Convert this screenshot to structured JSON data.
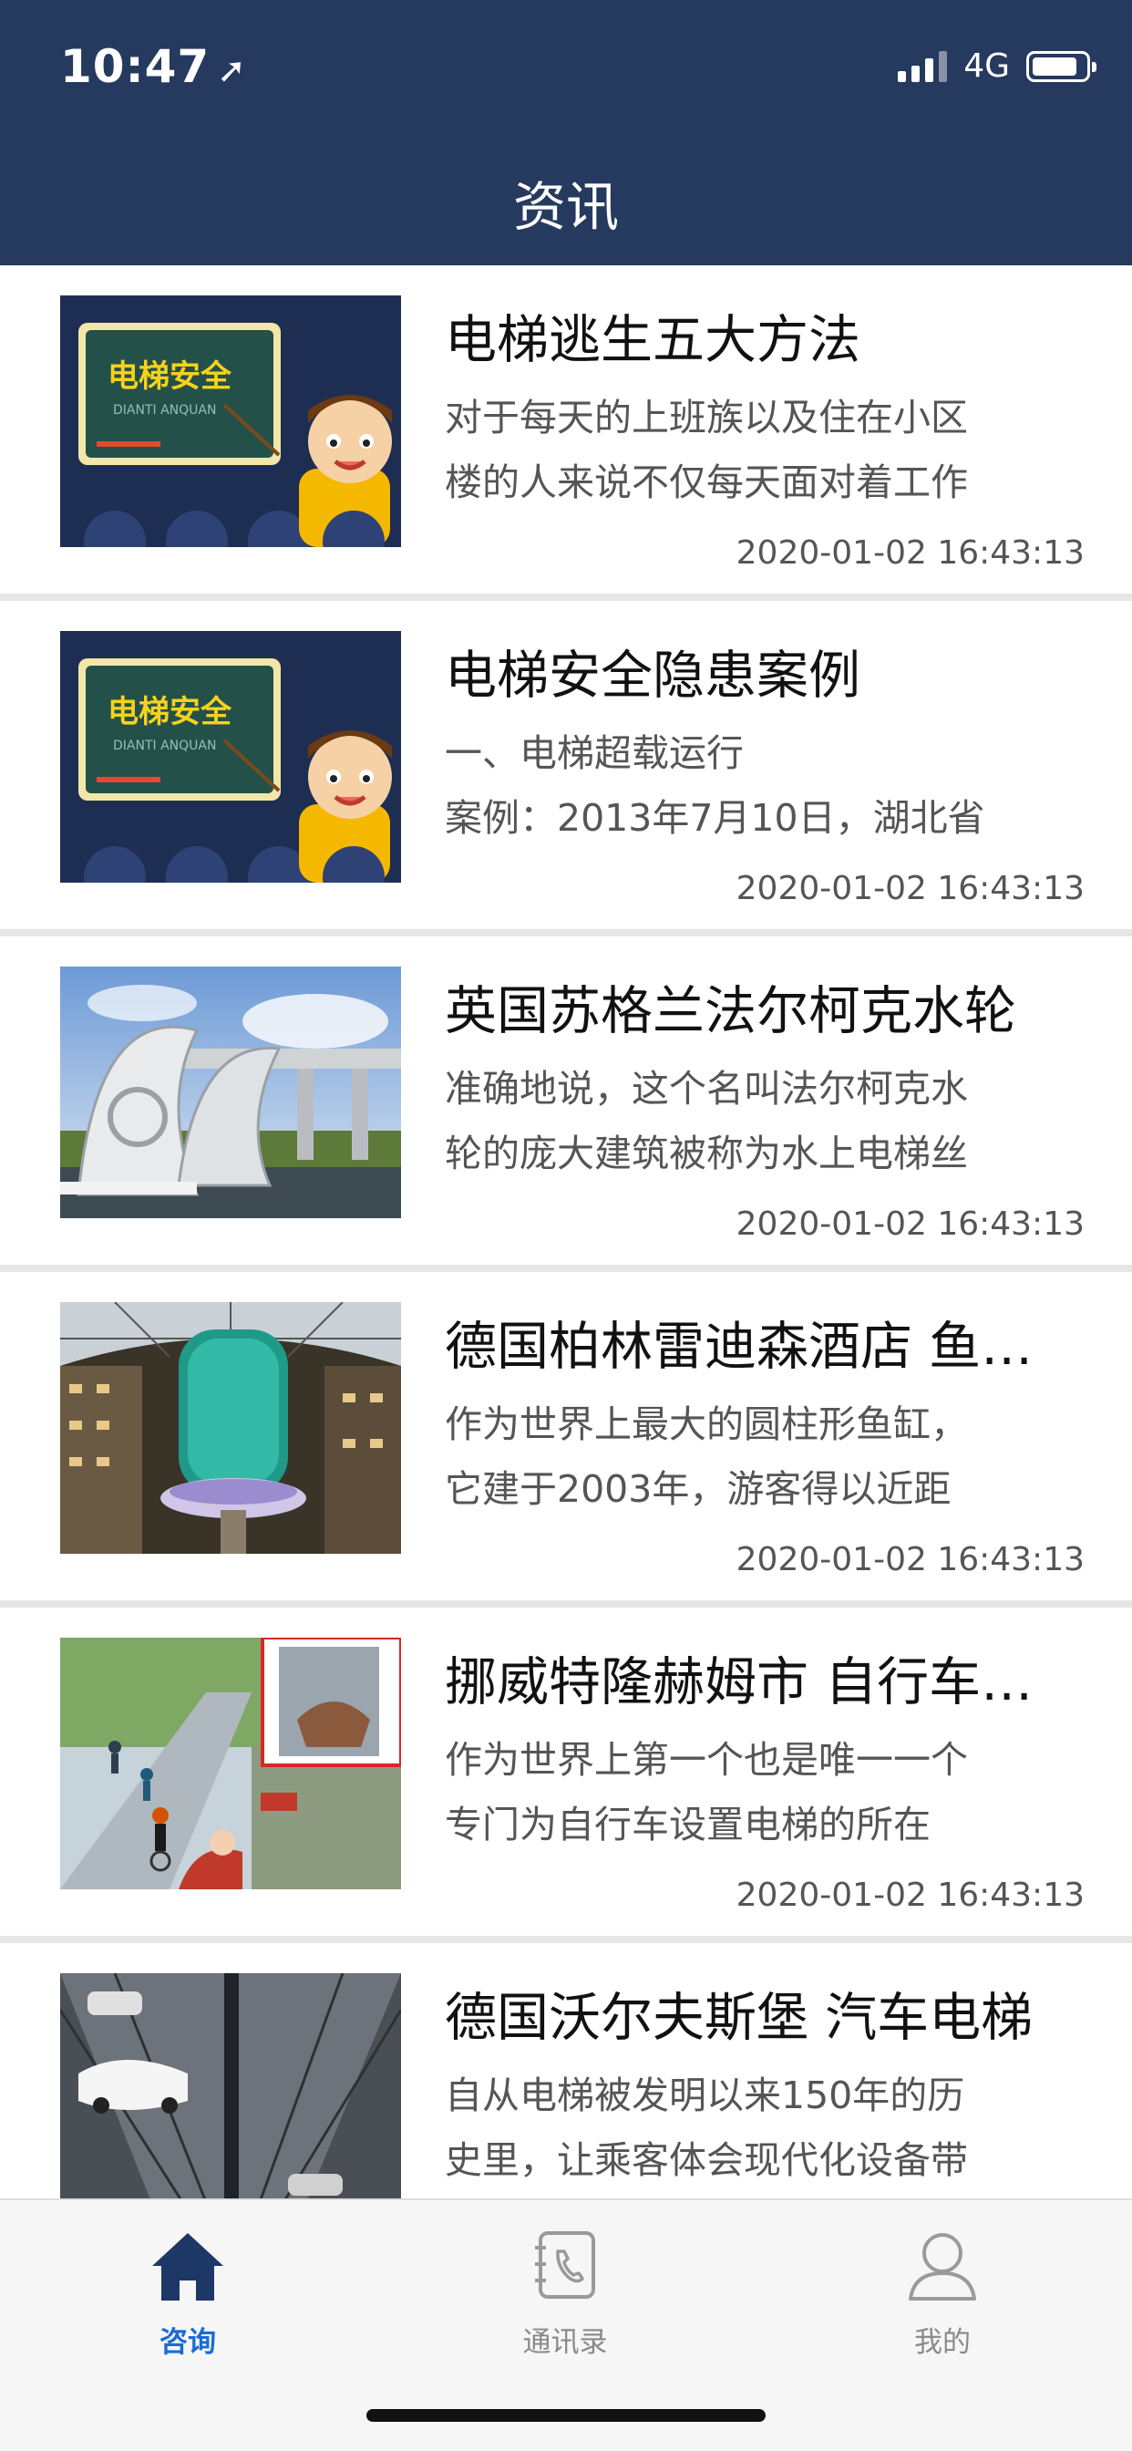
{
  "status": {
    "time": "10:47",
    "network": "4G"
  },
  "header": {
    "title": "资讯"
  },
  "articles": [
    {
      "title": "电梯逃生五大方法",
      "summary_line1": "对于每天的上班族以及住在小区",
      "summary_line2": "楼的人来说不仅每天面对着工作",
      "date": "2020-01-02 16:43:13",
      "thumb_text": "电梯安全",
      "thumb_sub": "DIANTI ANQUAN"
    },
    {
      "title": "电梯安全隐患案例",
      "summary_line1": "一、电梯超载运行",
      "summary_line2": "案例：2013年7月10日，湖北省",
      "date": "2020-01-02 16:43:13",
      "thumb_text": "电梯安全",
      "thumb_sub": "DIANTI ANQUAN"
    },
    {
      "title": "英国苏格兰法尔柯克水轮",
      "summary_line1": "准确地说，这个名叫法尔柯克水",
      "summary_line2": "轮的庞大建筑被称为水上电梯丝",
      "date": "2020-01-02 16:43:13"
    },
    {
      "title": "德国柏林雷迪森酒店 鱼缸电梯",
      "summary_line1": "作为世界上最大的圆柱形鱼缸，",
      "summary_line2": "它建于2003年，游客得以近距",
      "date": "2020-01-02 16:43:13"
    },
    {
      "title": "挪威特隆赫姆市 自行车电梯",
      "summary_line1": "作为世界上第一个也是唯一一个",
      "summary_line2": "专门为自行车设置电梯的所在",
      "date": "2020-01-02 16:43:13"
    },
    {
      "title": "德国沃尔夫斯堡 汽车电梯",
      "summary_line1": "自从电梯被发明以来150年的历",
      "summary_line2": "史里，让乘客体会现代化设备带",
      "date": ""
    }
  ],
  "tabs": [
    {
      "label": "咨询",
      "icon": "home-icon",
      "active": true
    },
    {
      "label": "通讯录",
      "icon": "contacts-icon",
      "active": false
    },
    {
      "label": "我的",
      "icon": "profile-icon",
      "active": false
    }
  ],
  "colors": {
    "header_bg": "#263a5f",
    "active_tab": "#1a6bd6",
    "inactive_tab": "#8a8a8a"
  }
}
